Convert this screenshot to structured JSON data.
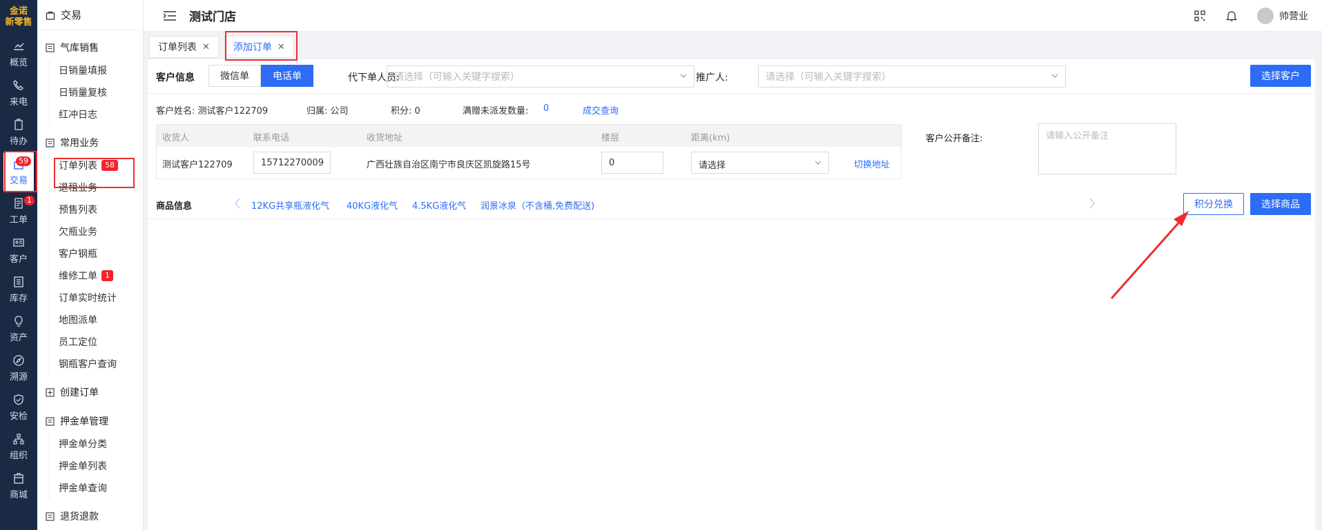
{
  "rail": {
    "logo_line1": "金诺",
    "logo_line2": "新零售",
    "items": [
      {
        "label": "概览",
        "icon": "chart-icon"
      },
      {
        "label": "来电",
        "icon": "phone-icon"
      },
      {
        "label": "待办",
        "icon": "clipboard-icon"
      },
      {
        "label": "交易",
        "icon": "bag-icon",
        "badge": "59",
        "active": true
      },
      {
        "label": "工单",
        "icon": "worksheet-icon",
        "badge": "1"
      },
      {
        "label": "客户",
        "icon": "id-card-icon"
      },
      {
        "label": "库存",
        "icon": "list-icon"
      },
      {
        "label": "资产",
        "icon": "bulb-icon"
      },
      {
        "label": "溯源",
        "icon": "compass-icon"
      },
      {
        "label": "安检",
        "icon": "shield-icon"
      },
      {
        "label": "组织",
        "icon": "org-icon"
      },
      {
        "label": "商城",
        "icon": "store-icon"
      }
    ]
  },
  "menu": {
    "title": "交易",
    "groups": [
      {
        "label": "气库销售",
        "items": [
          "日销量填报",
          "日销量复核",
          "红冲日志"
        ]
      },
      {
        "label": "常用业务",
        "items": [
          "订单列表",
          "退租业务",
          "预售列表",
          "欠瓶业务",
          "客户钢瓶",
          "维修工单",
          "订单实时统计",
          "地图派单",
          "员工定位",
          "钢瓶客户查询"
        ],
        "badges": {
          "订单列表": "58",
          "维修工单": "1"
        }
      },
      {
        "label": "创建订单",
        "items": []
      },
      {
        "label": "押金单管理",
        "items": [
          "押金单分类",
          "押金单列表",
          "押金单查询"
        ]
      },
      {
        "label": "退货退款",
        "items": []
      }
    ]
  },
  "header": {
    "store": "测试门店",
    "user": "帅营业"
  },
  "tabs": [
    {
      "label": "订单列表",
      "active": false
    },
    {
      "label": "添加订单",
      "active": true
    }
  ],
  "form": {
    "customer_info_label": "客户信息",
    "order_type_options": [
      "微信单",
      "电话单"
    ],
    "order_type_selected": "电话单",
    "agent_label": "代下单人员:",
    "agent_placeholder": "请选择（可输入关键字搜索）",
    "promoter_label": "推广人:",
    "promoter_placeholder": "请选择（可输入关键字搜索）",
    "choose_customer": "选择客户",
    "customer_name": "客户姓名: 测试客户122709",
    "belong": "归属: 公司",
    "points": "积分: 0",
    "gift_label": "满赠未派发数量:",
    "gift_value": "0",
    "deal_query": "成交查询",
    "address_table": {
      "headers": [
        "收货人",
        "联系电话",
        "收货地址",
        "楼层",
        "距离(km)"
      ],
      "row": {
        "receiver": "测试客户122709",
        "phone": "15712270009",
        "address": "广西壮族自治区南宁市良庆区凯旋路15号",
        "floor": "0",
        "distance": "请选择",
        "switch": "切换地址"
      }
    },
    "remark_label": "客户公开备注:",
    "remark_placeholder": "请输入公开备注",
    "goods_label": "商品信息",
    "goods_tabs": [
      "12KG共享瓶液化气",
      "40KG液化气",
      "4.5KG液化气",
      "润景冰泉（不含桶,免费配送)"
    ],
    "points_exchange": "积分兑换",
    "choose_goods": "选择商品"
  },
  "colors": {
    "primary": "#2d6cf6",
    "rail": "#1b2a44",
    "annotation": "#f02b2b"
  }
}
